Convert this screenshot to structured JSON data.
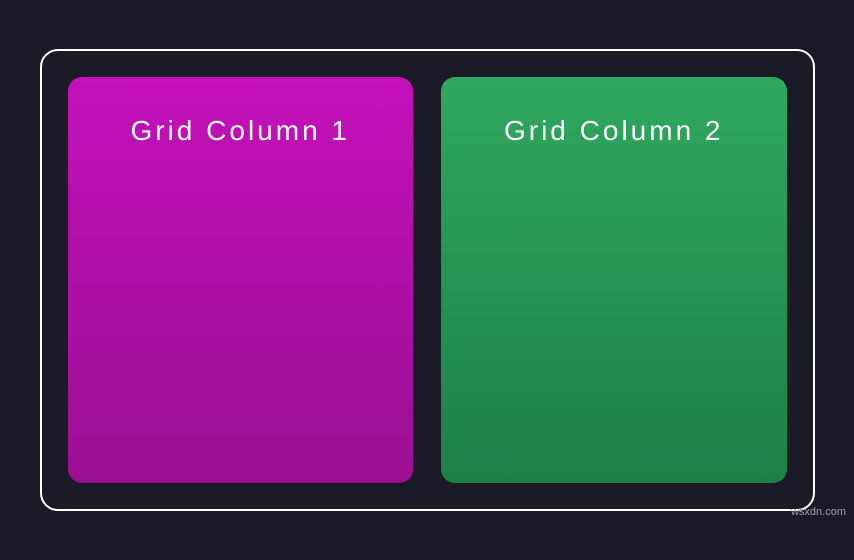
{
  "grid": {
    "columns": [
      {
        "label": "Grid Column 1",
        "gradient_top": "#c411bb",
        "gradient_bottom": "#9a0f92"
      },
      {
        "label": "Grid Column 2",
        "gradient_top": "#2fa85e",
        "gradient_bottom": "#1d8046"
      }
    ]
  },
  "container": {
    "border_color": "#ffffff"
  },
  "page": {
    "background": "#1a1b26"
  },
  "watermark": "wsxdn.com"
}
